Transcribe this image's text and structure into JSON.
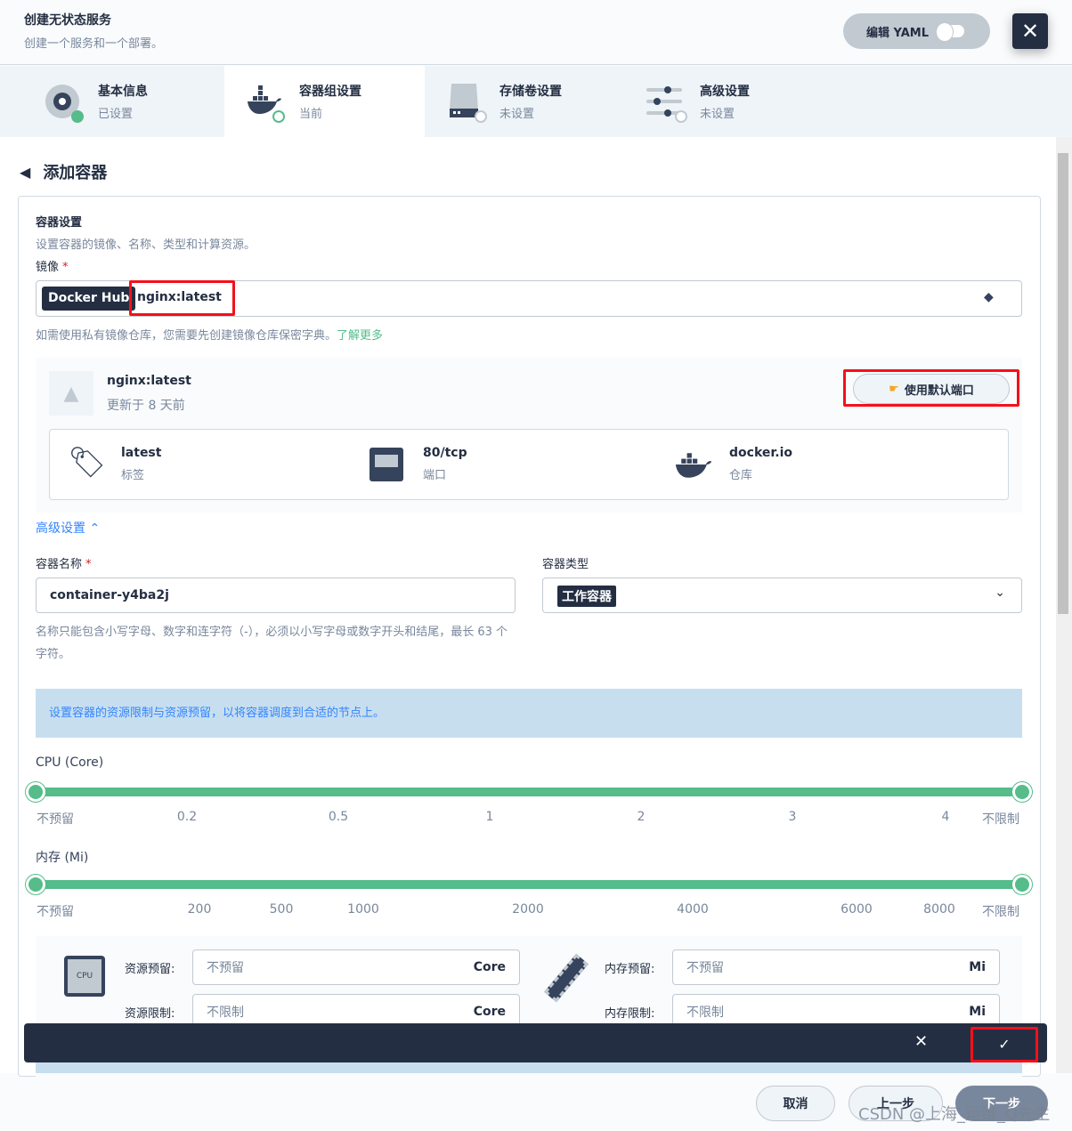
{
  "header": {
    "title": "创建无状态服务",
    "subtitle": "创建一个服务和一个部署。",
    "yaml_label": "编辑 YAML",
    "close_icon": "close-icon"
  },
  "steps": [
    {
      "label": "基本信息",
      "status": "已设置"
    },
    {
      "label": "容器组设置",
      "status": "当前"
    },
    {
      "label": "存储卷设置",
      "status": "未设置"
    },
    {
      "label": "高级设置",
      "status": "未设置"
    }
  ],
  "page": {
    "back_title": "添加容器"
  },
  "container_settings": {
    "title": "容器设置",
    "description": "设置容器的镜像、名称、类型和计算资源。",
    "image_label": "镜像",
    "required_mark": "*",
    "registry": "Docker Hub",
    "image_value": "nginx:latest",
    "hint": "如需使用私有镜像仓库，您需要先创建镜像仓库保密字典。",
    "learn_more": "了解更多"
  },
  "image_info": {
    "name": "nginx:latest",
    "updated": "更新于 8 天前",
    "use_default_ports": "使用默认端口",
    "items": [
      {
        "value": "latest",
        "label": "标签"
      },
      {
        "value": "80/tcp",
        "label": "端口"
      },
      {
        "value": "docker.io",
        "label": "仓库"
      }
    ]
  },
  "advanced_toggle": "高级设置",
  "container_name": {
    "label": "容器名称",
    "value": "container-y4ba2j",
    "hint": "名称只能包含小写字母、数字和连字符（-），必须以小写字母或数字开头和结尾，最长 63 个字符。"
  },
  "container_type": {
    "label": "容器类型",
    "value": "工作容器"
  },
  "resource_notice": "设置容器的资源限制与资源预留，以将容器调度到合适的节点上。",
  "cpu_slider": {
    "label": "CPU (Core)",
    "ticks": [
      "不预留",
      "0.2",
      "0.5",
      "1",
      "2",
      "3",
      "4",
      "不限制"
    ],
    "selected_range": [
      "不预留",
      "不限制"
    ]
  },
  "memory_slider": {
    "label": "内存 (Mi)",
    "ticks": [
      "不预留",
      "200",
      "500",
      "1000",
      "2000",
      "4000",
      "6000",
      "8000",
      "不限制"
    ],
    "selected_range": [
      "不预留",
      "不限制"
    ]
  },
  "resources": {
    "cpu_icon_text": "CPU",
    "cpu_request_label": "资源预留:",
    "cpu_request_placeholder": "不预留",
    "cpu_unit": "Core",
    "cpu_limit_label": "资源限制:",
    "cpu_limit_placeholder": "不限制",
    "mem_request_label": "内存预留:",
    "mem_request_placeholder": "不预留",
    "mem_unit": "Mi",
    "mem_limit_label": "内存限制:",
    "mem_limit_placeholder": "不限制"
  },
  "footer": {
    "cancel": "取消",
    "prev": "上一步",
    "next": "下一步"
  },
  "watermark": "CSDN @上海_运维_Q先生",
  "colors": {
    "accent": "#55bc8a",
    "dark": "#242e42",
    "highlight": "#f5101a",
    "notice_bg": "#c7deef"
  }
}
